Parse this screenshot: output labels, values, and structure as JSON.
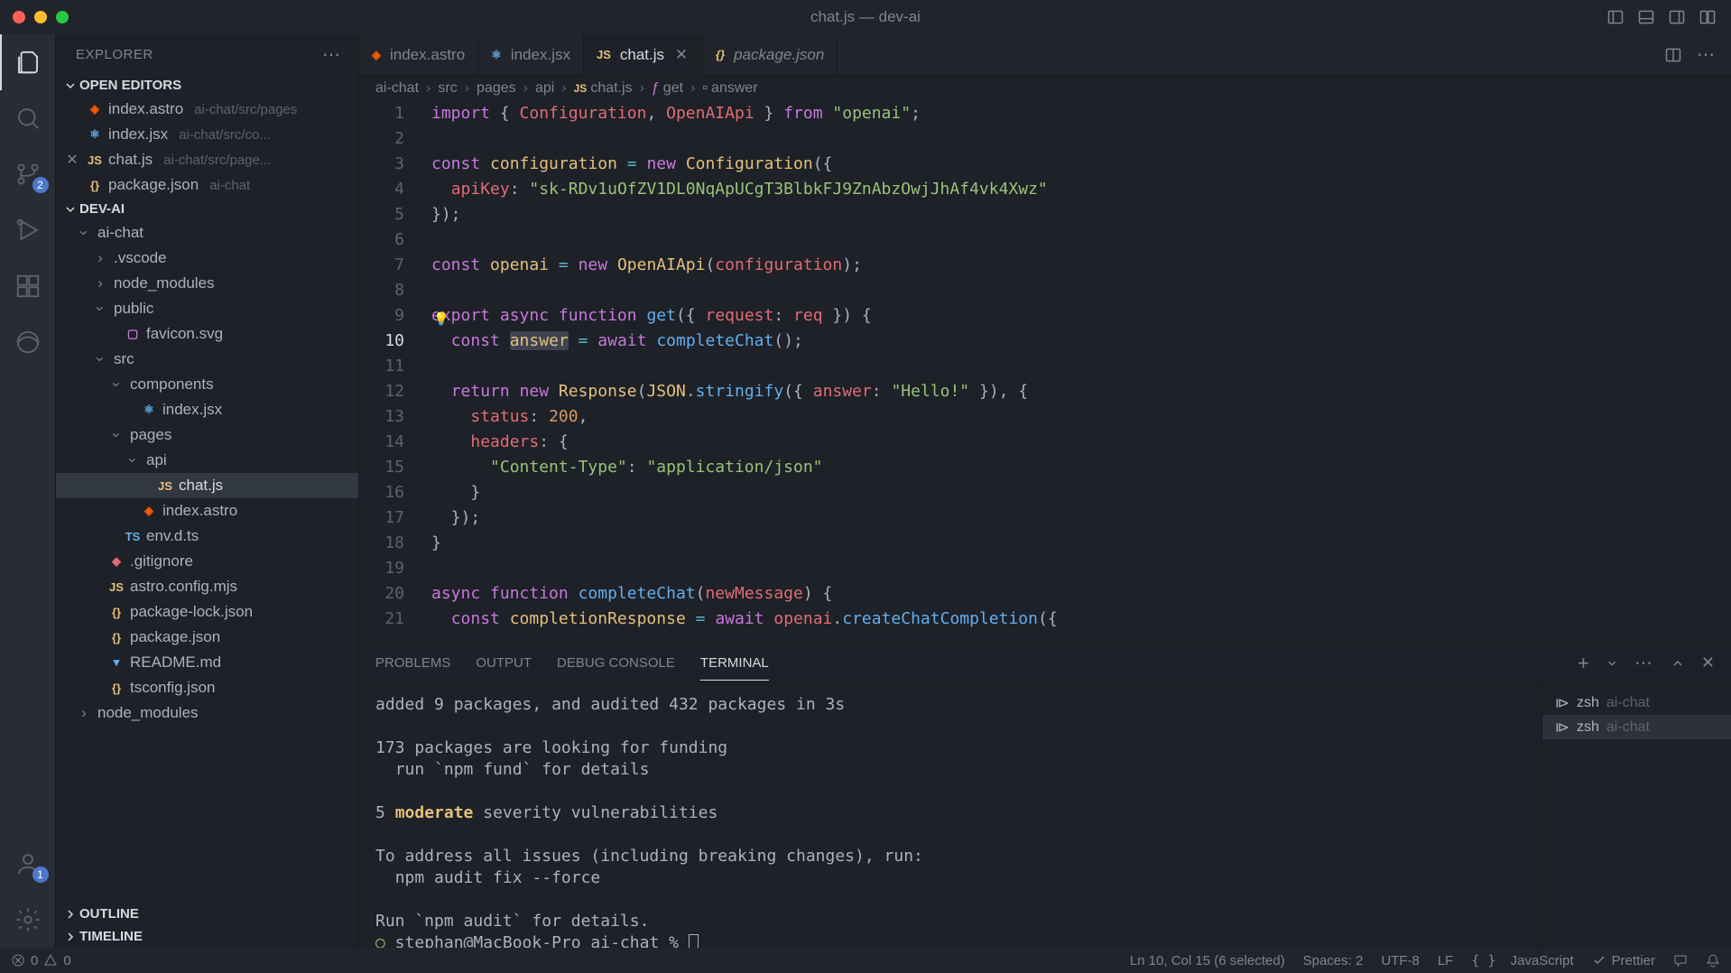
{
  "window_title": "chat.js — dev-ai",
  "activity": {
    "scm_badge": "2",
    "account_badge": "1"
  },
  "explorer": {
    "title": "EXPLORER",
    "open_editors_label": "OPEN EDITORS",
    "open_editors": [
      {
        "name": "index.astro",
        "path": "ai-chat/src/pages",
        "icon": "astro"
      },
      {
        "name": "index.jsx",
        "path": "ai-chat/src/co...",
        "icon": "jsx"
      },
      {
        "name": "chat.js",
        "path": "ai-chat/src/page...",
        "icon": "js",
        "close": true
      },
      {
        "name": "package.json",
        "path": "ai-chat",
        "icon": "json"
      }
    ],
    "workspace_label": "DEV-AI",
    "tree": [
      {
        "name": "ai-chat",
        "indent": 0,
        "type": "folder",
        "open": true
      },
      {
        "name": ".vscode",
        "indent": 1,
        "type": "folder"
      },
      {
        "name": "node_modules",
        "indent": 1,
        "type": "folder"
      },
      {
        "name": "public",
        "indent": 1,
        "type": "folder",
        "open": true
      },
      {
        "name": "favicon.svg",
        "indent": 2,
        "type": "file",
        "icon": "svg-i"
      },
      {
        "name": "src",
        "indent": 1,
        "type": "folder",
        "open": true
      },
      {
        "name": "components",
        "indent": 2,
        "type": "folder",
        "open": true
      },
      {
        "name": "index.jsx",
        "indent": 3,
        "type": "file",
        "icon": "jsx"
      },
      {
        "name": "pages",
        "indent": 2,
        "type": "folder",
        "open": true
      },
      {
        "name": "api",
        "indent": 3,
        "type": "folder",
        "open": true
      },
      {
        "name": "chat.js",
        "indent": 4,
        "type": "file",
        "icon": "js",
        "selected": true
      },
      {
        "name": "index.astro",
        "indent": 3,
        "type": "file",
        "icon": "astro"
      },
      {
        "name": "env.d.ts",
        "indent": 2,
        "type": "file",
        "icon": "ts"
      },
      {
        "name": ".gitignore",
        "indent": 1,
        "type": "file",
        "icon": "git"
      },
      {
        "name": "astro.config.mjs",
        "indent": 1,
        "type": "file",
        "icon": "js"
      },
      {
        "name": "package-lock.json",
        "indent": 1,
        "type": "file",
        "icon": "json"
      },
      {
        "name": "package.json",
        "indent": 1,
        "type": "file",
        "icon": "json"
      },
      {
        "name": "README.md",
        "indent": 1,
        "type": "file",
        "icon": "md"
      },
      {
        "name": "tsconfig.json",
        "indent": 1,
        "type": "file",
        "icon": "json"
      },
      {
        "name": "node_modules",
        "indent": 0,
        "type": "folder"
      }
    ],
    "outline_label": "OUTLINE",
    "timeline_label": "TIMELINE"
  },
  "tabs": [
    {
      "name": "index.astro",
      "icon": "astro"
    },
    {
      "name": "index.jsx",
      "icon": "jsx"
    },
    {
      "name": "chat.js",
      "icon": "js",
      "active": true,
      "close": true
    },
    {
      "name": "package.json",
      "icon": "json",
      "italic": true
    }
  ],
  "breadcrumb": [
    "ai-chat",
    "src",
    "pages",
    "api",
    "chat.js",
    "get",
    "answer"
  ],
  "code": {
    "start_line": 1,
    "current_line": 10,
    "lines": [
      [
        [
          "k-purple",
          "import"
        ],
        [
          "k-fg",
          " { "
        ],
        [
          "k-red",
          "Configuration"
        ],
        [
          "k-fg",
          ", "
        ],
        [
          "k-red",
          "OpenAIApi"
        ],
        [
          "k-fg",
          " } "
        ],
        [
          "k-purple",
          "from"
        ],
        [
          "k-fg",
          " "
        ],
        [
          "k-green",
          "\"openai\""
        ],
        [
          "k-fg",
          ";"
        ]
      ],
      [],
      [
        [
          "k-purple",
          "const"
        ],
        [
          "k-fg",
          " "
        ],
        [
          "k-yellow",
          "configuration"
        ],
        [
          "k-fg",
          " "
        ],
        [
          "k-cyan",
          "="
        ],
        [
          "k-fg",
          " "
        ],
        [
          "k-purple",
          "new"
        ],
        [
          "k-fg",
          " "
        ],
        [
          "k-yellow",
          "Configuration"
        ],
        [
          "k-fg",
          "({"
        ]
      ],
      [
        [
          "k-fg",
          "  "
        ],
        [
          "k-red",
          "apiKey"
        ],
        [
          "k-fg",
          ": "
        ],
        [
          "k-green",
          "\"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\""
        ]
      ],
      [
        [
          "k-fg",
          "});"
        ]
      ],
      [],
      [
        [
          "k-purple",
          "const"
        ],
        [
          "k-fg",
          " "
        ],
        [
          "k-yellow",
          "openai"
        ],
        [
          "k-fg",
          " "
        ],
        [
          "k-cyan",
          "="
        ],
        [
          "k-fg",
          " "
        ],
        [
          "k-purple",
          "new"
        ],
        [
          "k-fg",
          " "
        ],
        [
          "k-yellow",
          "OpenAIApi"
        ],
        [
          "k-fg",
          "("
        ],
        [
          "k-red",
          "configuration"
        ],
        [
          "k-fg",
          ");"
        ]
      ],
      [],
      [
        [
          "k-purple",
          "export"
        ],
        [
          "k-fg",
          " "
        ],
        [
          "k-purple",
          "async"
        ],
        [
          "k-fg",
          " "
        ],
        [
          "k-purple",
          "function"
        ],
        [
          "k-fg",
          " "
        ],
        [
          "k-blue",
          "get"
        ],
        [
          "k-fg",
          "({ "
        ],
        [
          "k-red",
          "request"
        ],
        [
          "k-fg",
          ": "
        ],
        [
          "k-red",
          "req"
        ],
        [
          "k-fg",
          " }) {"
        ]
      ],
      [
        [
          "k-fg",
          "  "
        ],
        [
          "k-purple",
          "const"
        ],
        [
          "k-fg",
          " "
        ],
        [
          "sel k-yellow",
          "answer"
        ],
        [
          "k-fg",
          " "
        ],
        [
          "k-cyan",
          "="
        ],
        [
          "k-fg",
          " "
        ],
        [
          "k-purple",
          "await"
        ],
        [
          "k-fg",
          " "
        ],
        [
          "k-blue",
          "completeChat"
        ],
        [
          "k-fg",
          "();"
        ]
      ],
      [],
      [
        [
          "k-fg",
          "  "
        ],
        [
          "k-purple",
          "return"
        ],
        [
          "k-fg",
          " "
        ],
        [
          "k-purple",
          "new"
        ],
        [
          "k-fg",
          " "
        ],
        [
          "k-yellow",
          "Response"
        ],
        [
          "k-fg",
          "("
        ],
        [
          "k-yellow",
          "JSON"
        ],
        [
          "k-fg",
          "."
        ],
        [
          "k-blue",
          "stringify"
        ],
        [
          "k-fg",
          "({ "
        ],
        [
          "k-red",
          "answer"
        ],
        [
          "k-fg",
          ": "
        ],
        [
          "k-green",
          "\"Hello!\""
        ],
        [
          "k-fg",
          " }), {"
        ]
      ],
      [
        [
          "k-fg",
          "    "
        ],
        [
          "k-red",
          "status"
        ],
        [
          "k-fg",
          ": "
        ],
        [
          "k-orange",
          "200"
        ],
        [
          "k-fg",
          ","
        ]
      ],
      [
        [
          "k-fg",
          "    "
        ],
        [
          "k-red",
          "headers"
        ],
        [
          "k-fg",
          ": {"
        ]
      ],
      [
        [
          "k-fg",
          "      "
        ],
        [
          "k-green",
          "\"Content-Type\""
        ],
        [
          "k-fg",
          ": "
        ],
        [
          "k-green",
          "\"application/json\""
        ]
      ],
      [
        [
          "k-fg",
          "    }"
        ]
      ],
      [
        [
          "k-fg",
          "  });"
        ]
      ],
      [
        [
          "k-fg",
          "}"
        ]
      ],
      [],
      [
        [
          "k-purple",
          "async"
        ],
        [
          "k-fg",
          " "
        ],
        [
          "k-purple",
          "function"
        ],
        [
          "k-fg",
          " "
        ],
        [
          "k-blue",
          "completeChat"
        ],
        [
          "k-fg",
          "("
        ],
        [
          "k-red",
          "newMessage"
        ],
        [
          "k-fg",
          ") {"
        ]
      ],
      [
        [
          "k-fg",
          "  "
        ],
        [
          "k-purple",
          "const"
        ],
        [
          "k-fg",
          " "
        ],
        [
          "k-yellow",
          "completionResponse"
        ],
        [
          "k-fg",
          " "
        ],
        [
          "k-cyan",
          "="
        ],
        [
          "k-fg",
          " "
        ],
        [
          "k-purple",
          "await"
        ],
        [
          "k-fg",
          " "
        ],
        [
          "k-red",
          "openai"
        ],
        [
          "k-fg",
          "."
        ],
        [
          "k-blue",
          "createChatCompletion"
        ],
        [
          "k-fg",
          "({"
        ]
      ]
    ]
  },
  "panel": {
    "tabs": [
      "PROBLEMS",
      "OUTPUT",
      "DEBUG CONSOLE",
      "TERMINAL"
    ],
    "active_tab": 3,
    "terminal_output": "added 9 packages, and audited 432 packages in 3s\n\n173 packages are looking for funding\n  run `npm fund` for details\n\n5 <span class='mod'>moderate</span> severity vulnerabilities\n\nTo address all issues (including breaking changes), run:\n  npm audit fix --force\n\nRun `npm audit` for details.\n<span style='color:#98c379'>○</span> stephan@MacBook-Pro ai-chat % <span class='prompt-cursor'></span>",
    "terminals": [
      {
        "name": "zsh",
        "cwd": "ai-chat"
      },
      {
        "name": "zsh",
        "cwd": "ai-chat",
        "active": true
      }
    ]
  },
  "status": {
    "errors": "0",
    "warnings": "0",
    "cursor": "Ln 10, Col 15 (6 selected)",
    "spaces": "Spaces: 2",
    "encoding": "UTF-8",
    "eol": "LF",
    "language": "JavaScript",
    "prettier": "Prettier"
  }
}
